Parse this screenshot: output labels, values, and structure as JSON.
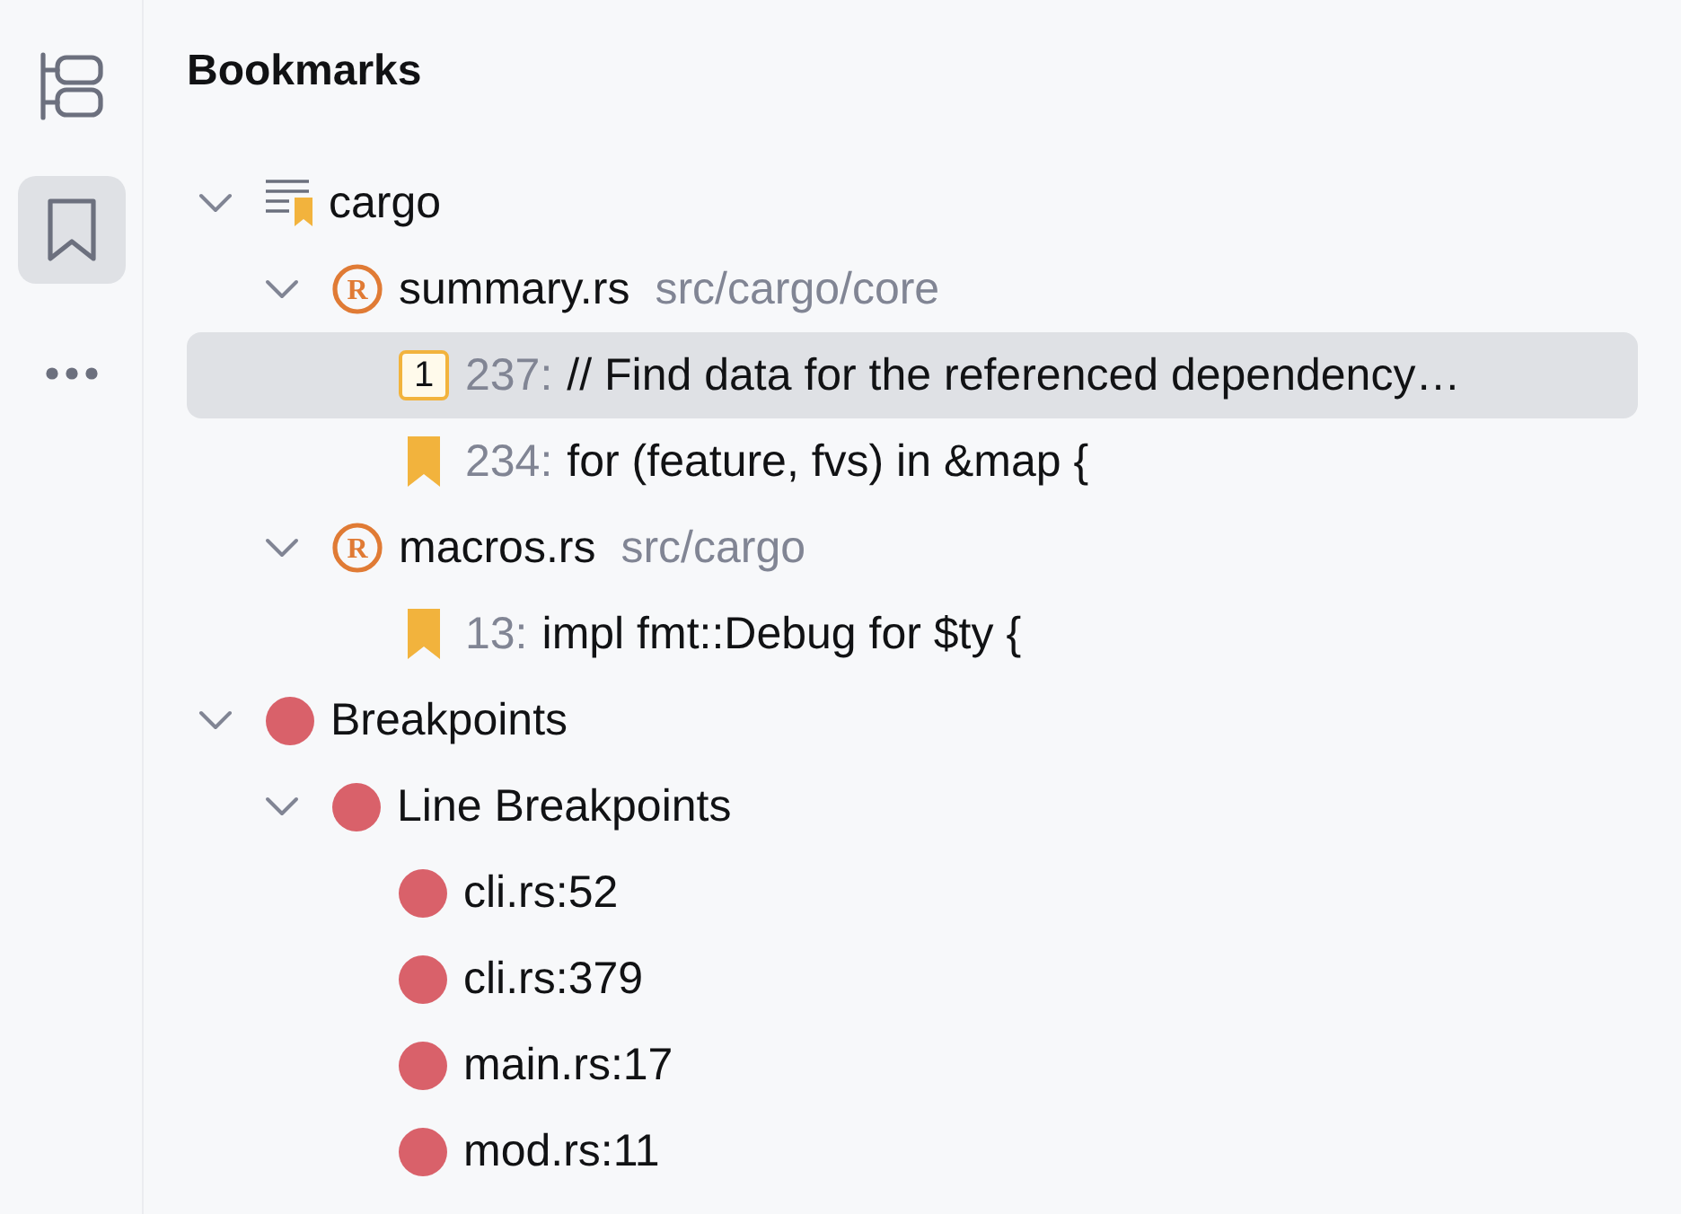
{
  "sidebar": {
    "items": [
      {
        "kind": "structure",
        "selected": false
      },
      {
        "kind": "bookmarks",
        "selected": true
      },
      {
        "kind": "more",
        "selected": false
      }
    ]
  },
  "panel": {
    "title": "Bookmarks"
  },
  "tree": [
    {
      "kind": "bookmark_list",
      "label": "cargo",
      "expanded": true,
      "selected": false,
      "children": [
        {
          "kind": "file",
          "badge": "R",
          "label": "summary.rs",
          "path": "src/cargo/core",
          "expanded": true,
          "selected": false,
          "children": [
            {
              "kind": "bookmark",
              "mnemonic": "1",
              "line": "237:",
              "text": "// Find data for the referenced dependency…",
              "selected": true
            },
            {
              "kind": "bookmark",
              "line": "234:",
              "text": "for (feature, fvs) in &map {",
              "selected": false
            }
          ]
        },
        {
          "kind": "file",
          "badge": "R",
          "label": "macros.rs",
          "path": "src/cargo",
          "expanded": true,
          "selected": false,
          "children": [
            {
              "kind": "bookmark",
              "line": "13:",
              "text": "impl fmt::Debug for $ty {",
              "selected": false
            }
          ]
        }
      ]
    },
    {
      "kind": "breakpoints",
      "label": "Breakpoints",
      "expanded": true,
      "selected": false,
      "children": [
        {
          "kind": "breakpoint_group",
          "label": "Line Breakpoints",
          "expanded": true,
          "selected": false,
          "children": [
            {
              "kind": "breakpoint",
              "label": "cli.rs:52",
              "selected": false
            },
            {
              "kind": "breakpoint",
              "label": "cli.rs:379",
              "selected": false
            },
            {
              "kind": "breakpoint",
              "label": "main.rs:17",
              "selected": false
            },
            {
              "kind": "breakpoint",
              "label": "mod.rs:11",
              "selected": false
            }
          ]
        }
      ]
    }
  ]
}
